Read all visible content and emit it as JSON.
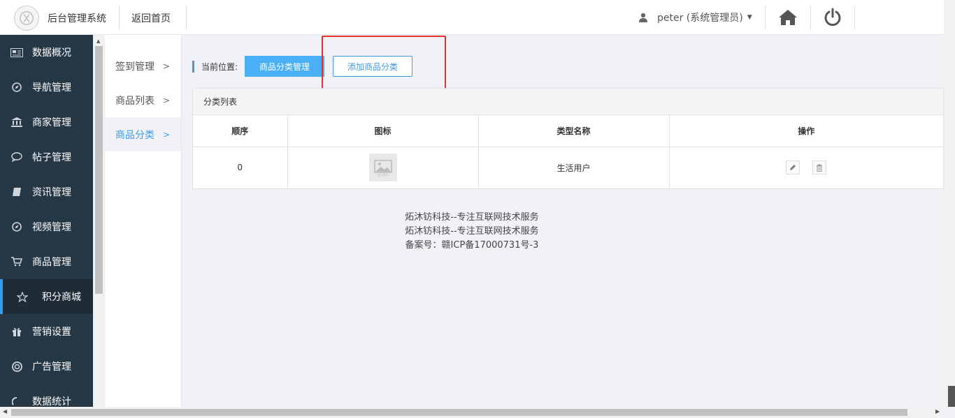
{
  "header": {
    "app_title": "后台管理系统",
    "back_home": "返回首页",
    "user": "peter (系统管理员)"
  },
  "sidebar": {
    "items": [
      {
        "label": "数据概况",
        "icon": "dashboard-icon"
      },
      {
        "label": "导航管理",
        "icon": "compass-icon"
      },
      {
        "label": "商家管理",
        "icon": "bank-icon"
      },
      {
        "label": "帖子管理",
        "icon": "comment-icon"
      },
      {
        "label": "资讯管理",
        "icon": "book-icon"
      },
      {
        "label": "视频管理",
        "icon": "compass-icon"
      },
      {
        "label": "商品管理",
        "icon": "cart-icon"
      },
      {
        "label": "积分商城",
        "icon": "star-icon"
      },
      {
        "label": "营销设置",
        "icon": "gift-icon"
      },
      {
        "label": "广告管理",
        "icon": "lifebuoy-icon"
      },
      {
        "label": "数据统计",
        "icon": "chart-icon"
      }
    ],
    "active": "积分商城"
  },
  "submenu": {
    "items": [
      {
        "label": "签到管理"
      },
      {
        "label": "商品列表"
      },
      {
        "label": "商品分类"
      }
    ],
    "active": "商品分类"
  },
  "breadcrumb": {
    "label": "当前位置:",
    "current": "商品分类管理",
    "add_button": "添加商品分类"
  },
  "panel": {
    "title": "分类列表",
    "columns": [
      "顺序",
      "图标",
      "类型名称",
      "操作"
    ],
    "rows": [
      {
        "order": "0",
        "icon_alt": "暂无图片",
        "name": "生活用户"
      }
    ]
  },
  "footer": {
    "line1": "炻沐钫科技--专注互联网技术服务",
    "line2": "炻沐钫科技--专注互联网技术服务",
    "line3": "备案号：赣ICP备17000731号-3"
  },
  "colors": {
    "sidebar_bg": "#263846",
    "accent": "#3c9be8",
    "primary_button": "#4ab0f5",
    "highlight_border": "#e53030"
  }
}
